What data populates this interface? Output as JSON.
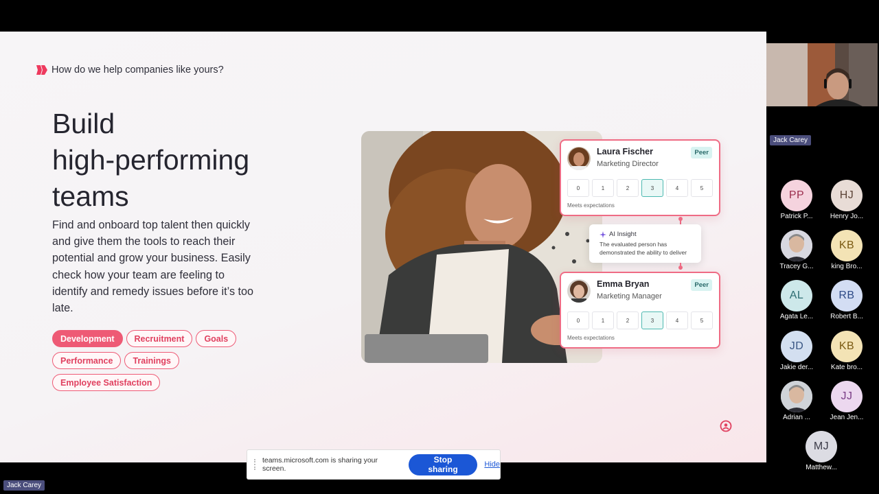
{
  "slide": {
    "kicker": "How do we help companies like yours?",
    "title_lines": [
      "Build",
      "high-performing",
      "teams"
    ],
    "body": "Find and onboard top talent then quickly and give them the tools to reach their potential and grow your business. Easily check how your team are feeling to identify and remedy issues before it’s too late.",
    "tags": [
      {
        "label": "Development",
        "active": true
      },
      {
        "label": "Recruitment",
        "active": false
      },
      {
        "label": "Goals",
        "active": false
      },
      {
        "label": "Performance",
        "active": false
      },
      {
        "label": "Trainings",
        "active": false
      },
      {
        "label": "Employee Satisfaction",
        "active": false
      }
    ],
    "cards": [
      {
        "name": "Laura Fischer",
        "role": "Marketing Director",
        "badge": "Peer",
        "scale": [
          "0",
          "1",
          "2",
          "3",
          "4",
          "5"
        ],
        "selected": "3",
        "footer": "Meets expectations"
      },
      {
        "name": "Emma Bryan",
        "role": "Marketing Manager",
        "badge": "Peer",
        "scale": [
          "0",
          "1",
          "2",
          "3",
          "4",
          "5"
        ],
        "selected": "3",
        "footer": "Meets expectations"
      }
    ],
    "insight": {
      "title": "AI Insight",
      "text": "The evaluated person has demonstrated the ability to deliver"
    },
    "colors": {
      "accent": "#ee5a75",
      "teal": "#4cb8b0"
    }
  },
  "share_bar": {
    "message": "teams.microsoft.com is sharing your screen.",
    "stop_label": "Stop sharing",
    "hide_label": "Hide"
  },
  "presenter": {
    "name": "Jack Carey"
  },
  "self_view": {
    "name": "Jack Carey"
  },
  "participants": [
    {
      "initials": "PP",
      "name": "Patrick P...",
      "bg": "#f5d3de",
      "fg": "#9b2d4d",
      "photo": false
    },
    {
      "initials": "HJ",
      "name": "Henry Jo...",
      "bg": "#e8dcd6",
      "fg": "#5c4438",
      "photo": false
    },
    {
      "initials": "",
      "name": "Tracey G...",
      "bg": "#d8d8e0",
      "fg": "#333",
      "photo": true
    },
    {
      "initials": "KB",
      "name": "king Bro...",
      "bg": "#f3e3b5",
      "fg": "#7a5a12",
      "photo": false
    },
    {
      "initials": "AL",
      "name": "Agata Le...",
      "bg": "#cde8ea",
      "fg": "#2c6c72",
      "photo": false
    },
    {
      "initials": "RB",
      "name": "Robert B...",
      "bg": "#d3ddf3",
      "fg": "#2e4a86",
      "photo": false
    },
    {
      "initials": "JD",
      "name": "Jakie der...",
      "bg": "#d3dff0",
      "fg": "#3a5684",
      "photo": false
    },
    {
      "initials": "KB",
      "name": "Kate bro...",
      "bg": "#f3e3b5",
      "fg": "#7a5a12",
      "photo": false
    },
    {
      "initials": "",
      "name": "Adrian ...",
      "bg": "#cfd3d8",
      "fg": "#333",
      "photo": true
    },
    {
      "initials": "JJ",
      "name": "Jean Jen...",
      "bg": "#ecd8ef",
      "fg": "#7a3d86",
      "photo": false
    },
    {
      "initials": "MJ",
      "name": "Matthew...",
      "bg": "#dcdce3",
      "fg": "#3b3b48",
      "photo": false
    }
  ]
}
